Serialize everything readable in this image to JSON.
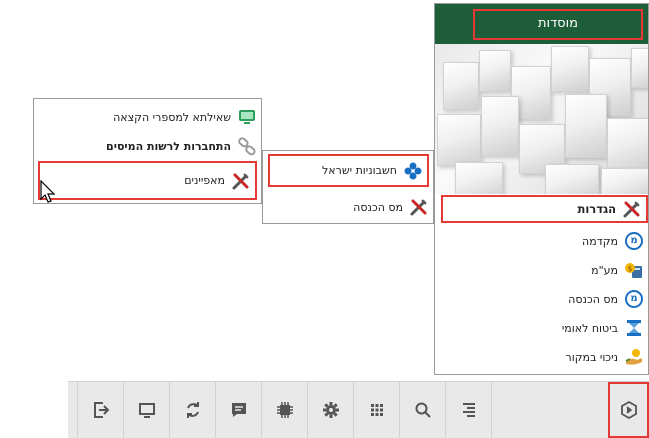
{
  "main_menu": {
    "title": "מוסדות",
    "items": [
      {
        "label": "הגדרות",
        "icon": "tools-icon",
        "highlighted": true
      },
      {
        "label": "מקדמה",
        "icon": "m-circle-icon"
      },
      {
        "label": "מע\"מ",
        "icon": "calculator-money-icon"
      },
      {
        "label": "מס הכנסה",
        "icon": "m-circle-icon"
      },
      {
        "label": "ביטוח לאומי",
        "icon": "hourglass-icon"
      },
      {
        "label": "ניכוי במקור",
        "icon": "hand-money-icon"
      }
    ]
  },
  "submenu_settings": {
    "items": [
      {
        "label": "חשבוניות ישראל",
        "icon": "blue-diamond-icon",
        "highlighted": true
      },
      {
        "label": "מס הכנסה",
        "icon": "tools-icon"
      }
    ]
  },
  "submenu_invoices": {
    "items": [
      {
        "label": "שאילתא למספרי הקצאה",
        "icon": "monitor-icon"
      },
      {
        "label": "התחברות לרשות המיסים",
        "icon": "link-icon",
        "bold": true
      },
      {
        "label": "מאפיינים",
        "icon": "tools-icon",
        "highlighted": true
      }
    ]
  },
  "toolbar": {
    "buttons": [
      "menu-arrow-icon",
      "list-icon",
      "search-icon",
      "grid-icon",
      "gear-icon",
      "chip-icon",
      "chat-icon",
      "refresh-icon",
      "monitor-icon",
      "logout-icon"
    ]
  },
  "colors": {
    "header_green": "#1d5e38",
    "highlight_red": "#e53935",
    "accent_blue": "#1b6fc2",
    "toolbar_bg": "#e9e9e9"
  }
}
